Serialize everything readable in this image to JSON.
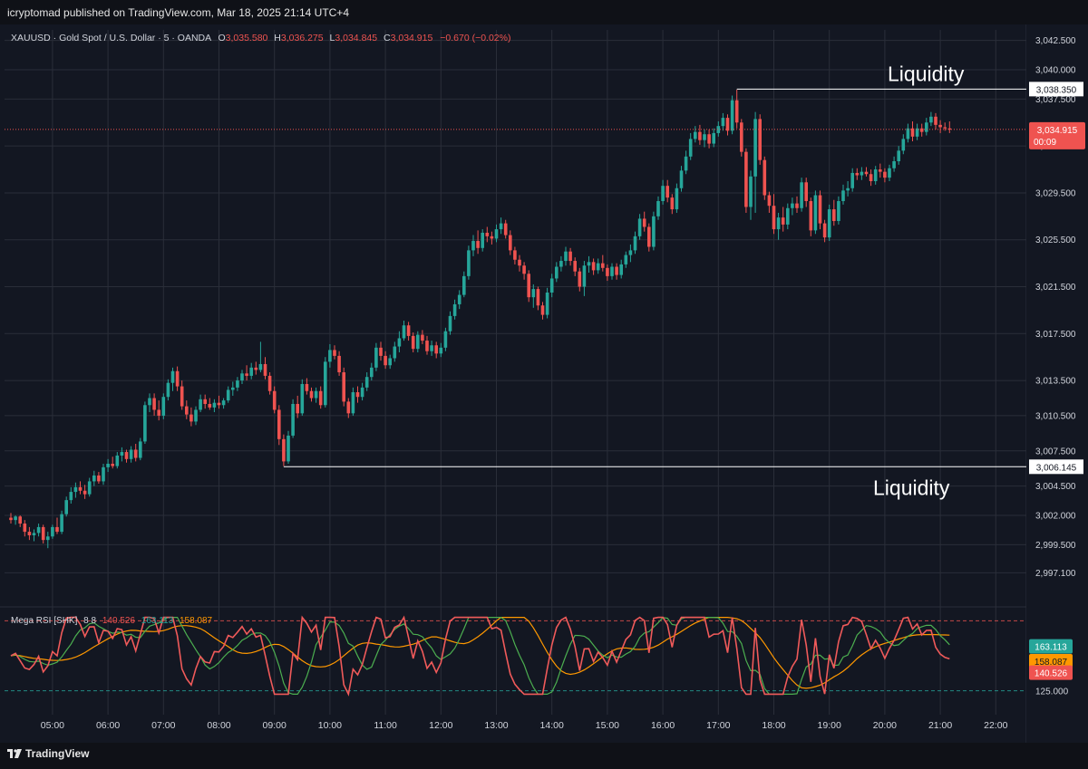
{
  "header": {
    "published_text": "icryptomad published on TradingView.com, Mar 18, 2025 21:14 UTC+4"
  },
  "footer": {
    "brand": "TradingView",
    "logo_icon": "tradingview-logo-icon"
  },
  "colors": {
    "background": "#131722",
    "up": "#26a69a",
    "down": "#ef5350",
    "grid": "#2a2e39",
    "text": "#d1d4dc",
    "rsi_fast": "#f05a5a",
    "rsi_green": "#4caf50",
    "rsi_orange": "#ff9800"
  },
  "chart_data": {
    "type": "candlestick",
    "symbol_line": {
      "symbol": "XAUUSD · Gold Spot / U.S. Dollar · 5 · OANDA",
      "o_label": "O",
      "o_value": "3,035.580",
      "h_label": "H",
      "h_value": "3,036.275",
      "l_label": "L",
      "l_value": "3,034.845",
      "c_label": "C",
      "c_value": "3,034.915",
      "change": "−0.670 (−0.02%)"
    },
    "y_axis": {
      "ylim": [
        2995.2,
        3043.4
      ],
      "ticks": [
        "3,042.500",
        "3,040.000",
        "3,037.500",
        "3,033.500",
        "3,029.500",
        "3,025.500",
        "3,021.500",
        "3,017.500",
        "3,013.500",
        "3,010.500",
        "3,007.500",
        "3,004.500",
        "3,002.000",
        "2,999.500",
        "2,997.100"
      ],
      "tick_values": [
        3042.5,
        3040.0,
        3037.5,
        3033.5,
        3029.5,
        3025.5,
        3021.5,
        3017.5,
        3013.5,
        3010.5,
        3007.5,
        3004.5,
        3002.0,
        2999.5,
        2997.1
      ]
    },
    "x_axis": {
      "ticks": [
        "05:00",
        "06:00",
        "07:00",
        "08:00",
        "09:00",
        "10:00",
        "11:00",
        "12:00",
        "13:00",
        "14:00",
        "15:00",
        "16:00",
        "17:00",
        "18:00",
        "19:00",
        "20:00",
        "21:00",
        "22:00"
      ],
      "first_candle_minutes": -45,
      "interval_minutes": 5,
      "tick_start_hour": 5
    },
    "candles": [
      [
        3001.8,
        3002.2,
        3001.3,
        3001.6
      ],
      [
        3001.6,
        3002.0,
        3001.2,
        3001.9
      ],
      [
        3001.9,
        3002.0,
        3001.0,
        3001.3
      ],
      [
        3001.3,
        3001.6,
        3000.2,
        3000.6
      ],
      [
        3000.6,
        3001.0,
        2999.9,
        3000.3
      ],
      [
        3000.3,
        3000.8,
        2999.8,
        3000.5
      ],
      [
        3000.5,
        3001.3,
        3000.2,
        3001.0
      ],
      [
        3001.0,
        3001.2,
        2999.6,
        2999.9
      ],
      [
        2999.9,
        3000.6,
        2999.2,
        3000.2
      ],
      [
        3000.2,
        3001.2,
        3000.0,
        3001.0
      ],
      [
        3001.0,
        3001.8,
        3000.4,
        3000.6
      ],
      [
        3000.6,
        3002.4,
        3000.4,
        3002.1
      ],
      [
        3002.1,
        3003.6,
        3001.9,
        3003.3
      ],
      [
        3003.3,
        3004.4,
        3003.0,
        3004.0
      ],
      [
        3004.0,
        3004.8,
        3003.5,
        3004.4
      ],
      [
        3004.4,
        3004.9,
        3003.8,
        3004.1
      ],
      [
        3004.1,
        3004.6,
        3003.4,
        3003.8
      ],
      [
        3003.8,
        3005.2,
        3003.6,
        3004.9
      ],
      [
        3004.9,
        3005.8,
        3004.5,
        3005.4
      ],
      [
        3005.4,
        3005.7,
        3004.7,
        3004.9
      ],
      [
        3004.9,
        3006.4,
        3004.6,
        3006.1
      ],
      [
        3006.1,
        3006.8,
        3005.7,
        3006.4
      ],
      [
        3006.4,
        3007.0,
        3006.0,
        3006.2
      ],
      [
        3006.2,
        3007.4,
        3006.0,
        3007.1
      ],
      [
        3007.1,
        3007.8,
        3006.6,
        3007.4
      ],
      [
        3007.4,
        3007.6,
        3006.5,
        3006.8
      ],
      [
        3006.8,
        3007.9,
        3006.5,
        3007.6
      ],
      [
        3007.6,
        3008.1,
        3006.6,
        3006.9
      ],
      [
        3006.9,
        3008.6,
        3006.7,
        3008.3
      ],
      [
        3008.3,
        3011.7,
        3008.1,
        3011.4
      ],
      [
        3011.4,
        3012.4,
        3010.8,
        3012.0
      ],
      [
        3012.0,
        3012.4,
        3010.5,
        3011.0
      ],
      [
        3011.0,
        3011.8,
        3010.1,
        3010.5
      ],
      [
        3010.5,
        3012.4,
        3010.2,
        3012.1
      ],
      [
        3012.1,
        3013.6,
        3011.8,
        3013.3
      ],
      [
        3013.3,
        3014.6,
        3012.6,
        3014.3
      ],
      [
        3014.3,
        3014.7,
        3012.6,
        3013.0
      ],
      [
        3013.0,
        3013.5,
        3011.0,
        3011.3
      ],
      [
        3011.3,
        3011.8,
        3010.2,
        3010.6
      ],
      [
        3010.6,
        3011.2,
        3009.6,
        3010.0
      ],
      [
        3010.0,
        3011.3,
        3009.7,
        3011.0
      ],
      [
        3011.0,
        3012.3,
        3010.8,
        3011.9
      ],
      [
        3011.9,
        3012.3,
        3011.1,
        3011.5
      ],
      [
        3011.5,
        3012.0,
        3011.0,
        3011.2
      ],
      [
        3011.2,
        3011.9,
        3010.8,
        3011.6
      ],
      [
        3011.6,
        3012.2,
        3011.1,
        3011.4
      ],
      [
        3011.4,
        3012.0,
        3011.1,
        3011.8
      ],
      [
        3011.8,
        3013.0,
        3011.6,
        3012.7
      ],
      [
        3012.7,
        3013.4,
        3012.2,
        3012.9
      ],
      [
        3012.9,
        3013.8,
        3012.6,
        3013.5
      ],
      [
        3013.5,
        3014.4,
        3013.2,
        3014.1
      ],
      [
        3014.1,
        3014.8,
        3013.5,
        3013.9
      ],
      [
        3013.9,
        3015.0,
        3013.6,
        3014.6
      ],
      [
        3014.6,
        3015.1,
        3014.0,
        3014.4
      ],
      [
        3014.4,
        3016.8,
        3014.2,
        3014.9
      ],
      [
        3014.9,
        3015.5,
        3013.6,
        3013.9
      ],
      [
        3013.9,
        3014.2,
        3012.3,
        3012.6
      ],
      [
        3012.6,
        3013.0,
        3010.7,
        3011.0
      ],
      [
        3011.0,
        3011.4,
        3008.0,
        3008.5
      ],
      [
        3008.5,
        3008.9,
        3006.2,
        3006.6
      ],
      [
        3006.6,
        3009.2,
        3006.4,
        3008.8
      ],
      [
        3008.8,
        3011.9,
        3008.6,
        3011.5
      ],
      [
        3011.5,
        3012.2,
        3010.3,
        3010.7
      ],
      [
        3010.7,
        3013.6,
        3010.5,
        3013.2
      ],
      [
        3013.2,
        3013.7,
        3012.3,
        3012.6
      ],
      [
        3012.6,
        3012.9,
        3011.7,
        3012.0
      ],
      [
        3012.0,
        3012.9,
        3011.6,
        3012.6
      ],
      [
        3012.6,
        3013.0,
        3011.1,
        3011.4
      ],
      [
        3011.4,
        3015.5,
        3011.2,
        3015.1
      ],
      [
        3015.1,
        3016.6,
        3014.6,
        3016.1
      ],
      [
        3016.1,
        3016.5,
        3015.3,
        3015.6
      ],
      [
        3015.6,
        3016.0,
        3013.9,
        3014.2
      ],
      [
        3014.2,
        3014.6,
        3011.3,
        3011.7
      ],
      [
        3011.7,
        3012.0,
        3010.3,
        3010.7
      ],
      [
        3010.7,
        3012.9,
        3010.5,
        3012.5
      ],
      [
        3012.5,
        3013.0,
        3011.6,
        3012.1
      ],
      [
        3012.1,
        3013.3,
        3011.8,
        3012.9
      ],
      [
        3012.9,
        3014.2,
        3012.6,
        3013.8
      ],
      [
        3013.8,
        3015.0,
        3013.5,
        3014.6
      ],
      [
        3014.6,
        3016.7,
        3014.3,
        3016.3
      ],
      [
        3016.3,
        3016.8,
        3015.2,
        3015.6
      ],
      [
        3015.6,
        3016.0,
        3014.5,
        3014.8
      ],
      [
        3014.8,
        3015.7,
        3014.5,
        3015.4
      ],
      [
        3015.4,
        3016.8,
        3015.1,
        3016.4
      ],
      [
        3016.4,
        3017.7,
        3015.9,
        3017.1
      ],
      [
        3017.1,
        3018.6,
        3016.9,
        3018.2
      ],
      [
        3018.2,
        3018.5,
        3016.9,
        3017.3
      ],
      [
        3017.3,
        3017.6,
        3015.9,
        3016.2
      ],
      [
        3016.2,
        3017.7,
        3015.9,
        3017.4
      ],
      [
        3017.4,
        3017.8,
        3016.6,
        3016.9
      ],
      [
        3016.9,
        3017.3,
        3015.7,
        3016.0
      ],
      [
        3016.0,
        3016.9,
        3015.6,
        3016.5
      ],
      [
        3016.5,
        3016.8,
        3015.4,
        3015.8
      ],
      [
        3015.8,
        3016.7,
        3015.5,
        3016.3
      ],
      [
        3016.3,
        3018.0,
        3016.0,
        3017.7
      ],
      [
        3017.7,
        3019.4,
        3017.4,
        3019.0
      ],
      [
        3019.0,
        3020.4,
        3018.7,
        3020.0
      ],
      [
        3020.0,
        3021.2,
        3019.6,
        3020.8
      ],
      [
        3020.8,
        3022.8,
        3020.6,
        3022.4
      ],
      [
        3022.4,
        3025.0,
        3022.1,
        3024.6
      ],
      [
        3024.6,
        3025.9,
        3024.1,
        3025.4
      ],
      [
        3025.4,
        3026.3,
        3024.3,
        3024.8
      ],
      [
        3024.8,
        3026.4,
        3024.5,
        3026.1
      ],
      [
        3026.1,
        3026.6,
        3025.3,
        3025.8
      ],
      [
        3025.8,
        3026.2,
        3025.1,
        3025.6
      ],
      [
        3025.6,
        3026.8,
        3025.3,
        3026.4
      ],
      [
        3026.4,
        3027.4,
        3026.0,
        3026.9
      ],
      [
        3026.9,
        3027.2,
        3025.6,
        3025.9
      ],
      [
        3025.9,
        3026.3,
        3024.2,
        3024.6
      ],
      [
        3024.6,
        3024.9,
        3023.4,
        3023.8
      ],
      [
        3023.8,
        3024.2,
        3022.8,
        3023.3
      ],
      [
        3023.3,
        3023.6,
        3022.1,
        3022.6
      ],
      [
        3022.6,
        3022.9,
        3020.2,
        3020.6
      ],
      [
        3020.6,
        3021.7,
        3019.7,
        3021.3
      ],
      [
        3021.3,
        3021.5,
        3019.5,
        3019.9
      ],
      [
        3019.9,
        3020.2,
        3018.7,
        3019.1
      ],
      [
        3019.1,
        3021.4,
        3018.8,
        3021.0
      ],
      [
        3021.0,
        3022.6,
        3020.6,
        3022.2
      ],
      [
        3022.2,
        3023.6,
        3021.9,
        3023.2
      ],
      [
        3023.2,
        3024.1,
        3022.8,
        3023.7
      ],
      [
        3023.7,
        3024.9,
        3023.3,
        3024.5
      ],
      [
        3024.5,
        3024.8,
        3023.3,
        3023.7
      ],
      [
        3023.7,
        3024.0,
        3022.4,
        3022.8
      ],
      [
        3022.8,
        3023.1,
        3021.1,
        3021.5
      ],
      [
        3021.5,
        3023.7,
        3020.7,
        3023.3
      ],
      [
        3023.3,
        3024.1,
        3022.7,
        3023.6
      ],
      [
        3023.6,
        3023.9,
        3022.5,
        3022.9
      ],
      [
        3022.9,
        3023.9,
        3022.6,
        3023.5
      ],
      [
        3023.5,
        3024.2,
        3022.8,
        3023.1
      ],
      [
        3023.1,
        3023.4,
        3022.0,
        3022.4
      ],
      [
        3022.4,
        3023.5,
        3022.1,
        3023.2
      ],
      [
        3023.2,
        3023.5,
        3022.1,
        3022.5
      ],
      [
        3022.5,
        3023.8,
        3022.2,
        3023.4
      ],
      [
        3023.4,
        3024.5,
        3023.1,
        3024.2
      ],
      [
        3024.2,
        3025.1,
        3023.6,
        3024.6
      ],
      [
        3024.6,
        3026.2,
        3024.3,
        3025.8
      ],
      [
        3025.8,
        3027.7,
        3025.5,
        3027.3
      ],
      [
        3027.3,
        3027.9,
        3026.2,
        3026.6
      ],
      [
        3026.6,
        3026.9,
        3024.5,
        3024.9
      ],
      [
        3024.9,
        3027.9,
        3024.6,
        3027.5
      ],
      [
        3027.5,
        3029.2,
        3027.2,
        3028.8
      ],
      [
        3028.8,
        3030.6,
        3028.5,
        3030.1
      ],
      [
        3030.1,
        3030.6,
        3028.7,
        3029.1
      ],
      [
        3029.1,
        3029.4,
        3027.7,
        3028.1
      ],
      [
        3028.1,
        3030.3,
        3027.8,
        3029.9
      ],
      [
        3029.9,
        3031.8,
        3029.6,
        3031.4
      ],
      [
        3031.4,
        3033.1,
        3031.1,
        3032.6
      ],
      [
        3032.6,
        3034.6,
        3032.3,
        3034.1
      ],
      [
        3034.1,
        3035.2,
        3033.8,
        3034.7
      ],
      [
        3034.7,
        3035.3,
        3033.6,
        3034.0
      ],
      [
        3034.0,
        3034.9,
        3033.4,
        3034.5
      ],
      [
        3034.5,
        3034.9,
        3033.3,
        3033.7
      ],
      [
        3033.7,
        3035.0,
        3033.4,
        3034.6
      ],
      [
        3034.6,
        3035.6,
        3034.3,
        3035.2
      ],
      [
        3035.2,
        3036.3,
        3034.8,
        3035.9
      ],
      [
        3035.9,
        3036.2,
        3034.4,
        3034.8
      ],
      [
        3034.8,
        3037.8,
        3034.5,
        3037.4
      ],
      [
        3037.4,
        3038.3,
        3035.0,
        3035.5
      ],
      [
        3035.5,
        3035.8,
        3032.6,
        3033.0
      ],
      [
        3033.0,
        3033.3,
        3027.8,
        3028.3
      ],
      [
        3028.3,
        3031.4,
        3027.2,
        3030.9
      ],
      [
        3030.9,
        3036.4,
        3027.8,
        3035.8
      ],
      [
        3035.8,
        3036.2,
        3031.9,
        3032.3
      ],
      [
        3032.3,
        3032.6,
        3028.9,
        3029.3
      ],
      [
        3029.3,
        3029.6,
        3027.8,
        3028.4
      ],
      [
        3028.4,
        3029.4,
        3026.0,
        3026.4
      ],
      [
        3026.4,
        3027.8,
        3025.5,
        3027.4
      ],
      [
        3027.4,
        3028.3,
        3026.2,
        3026.8
      ],
      [
        3026.8,
        3028.6,
        3026.4,
        3028.2
      ],
      [
        3028.2,
        3029.1,
        3027.6,
        3028.6
      ],
      [
        3028.6,
        3029.2,
        3027.8,
        3028.2
      ],
      [
        3028.2,
        3030.8,
        3027.9,
        3030.4
      ],
      [
        3030.4,
        3030.8,
        3028.3,
        3028.8
      ],
      [
        3028.8,
        3029.1,
        3025.8,
        3026.3
      ],
      [
        3026.3,
        3029.7,
        3026.0,
        3029.3
      ],
      [
        3029.3,
        3029.7,
        3026.4,
        3026.9
      ],
      [
        3026.9,
        3027.2,
        3025.3,
        3025.7
      ],
      [
        3025.7,
        3028.5,
        3025.4,
        3028.1
      ],
      [
        3028.1,
        3028.9,
        3026.7,
        3027.1
      ],
      [
        3027.1,
        3029.2,
        3026.8,
        3028.8
      ],
      [
        3028.8,
        3030.2,
        3028.5,
        3029.7
      ],
      [
        3029.7,
        3030.5,
        3029.2,
        3029.9
      ],
      [
        3029.9,
        3031.6,
        3029.6,
        3031.2
      ],
      [
        3031.2,
        3031.6,
        3030.6,
        3031.0
      ],
      [
        3031.0,
        3031.7,
        3030.6,
        3031.3
      ],
      [
        3031.3,
        3031.7,
        3030.9,
        3031.1
      ],
      [
        3031.1,
        3031.5,
        3030.1,
        3030.5
      ],
      [
        3030.5,
        3031.8,
        3030.2,
        3031.5
      ],
      [
        3031.5,
        3032.0,
        3030.8,
        3031.3
      ],
      [
        3031.3,
        3031.6,
        3030.4,
        3030.8
      ],
      [
        3030.8,
        3031.9,
        3030.5,
        3031.6
      ],
      [
        3031.6,
        3032.6,
        3031.3,
        3032.2
      ],
      [
        3032.2,
        3033.5,
        3031.9,
        3033.1
      ],
      [
        3033.1,
        3034.5,
        3032.8,
        3034.1
      ],
      [
        3034.1,
        3035.4,
        3033.8,
        3035.0
      ],
      [
        3035.0,
        3035.6,
        3033.9,
        3034.3
      ],
      [
        3034.3,
        3035.4,
        3034.0,
        3035.0
      ],
      [
        3035.0,
        3035.4,
        3034.3,
        3034.7
      ],
      [
        3034.7,
        3035.9,
        3034.4,
        3035.5
      ],
      [
        3035.5,
        3036.4,
        3035.2,
        3036.0
      ],
      [
        3036.0,
        3036.3,
        3034.9,
        3035.3
      ],
      [
        3035.3,
        3035.7,
        3034.6,
        3035.1
      ],
      [
        3035.1,
        3035.5,
        3034.8,
        3035.0
      ],
      [
        3035.0,
        3035.6,
        3034.6,
        3034.9
      ]
    ],
    "levels": [
      {
        "label": "Liquidity",
        "value": 3038.35,
        "value_label": "3,038.350",
        "from_candle": 157
      },
      {
        "label": "Liquidity",
        "value": 3006.145,
        "value_label": "3,006.145",
        "from_candle": 59
      }
    ],
    "last_price": {
      "value": 3034.915,
      "label": "3,034.915",
      "countdown": "00:09"
    },
    "rsi_panel": {
      "title": "Mega RSI [SHK]",
      "params": "8  8",
      "values_text": [
        "140.526",
        "163.113",
        "158.087"
      ],
      "ylim": [
        120,
        190
      ],
      "levels": [
        {
          "value": 185,
          "color": "#ef5350"
        },
        {
          "value": 125,
          "color": "#26a69a",
          "label": "125.000"
        }
      ],
      "badges": [
        {
          "label": "163.113",
          "value": 163.113,
          "color": "#26a69a"
        },
        {
          "label": "158.087",
          "value": 158.087,
          "color": "#ff9800"
        },
        {
          "label": "140.526",
          "value": 140.526,
          "color": "#ef5350"
        }
      ]
    }
  }
}
